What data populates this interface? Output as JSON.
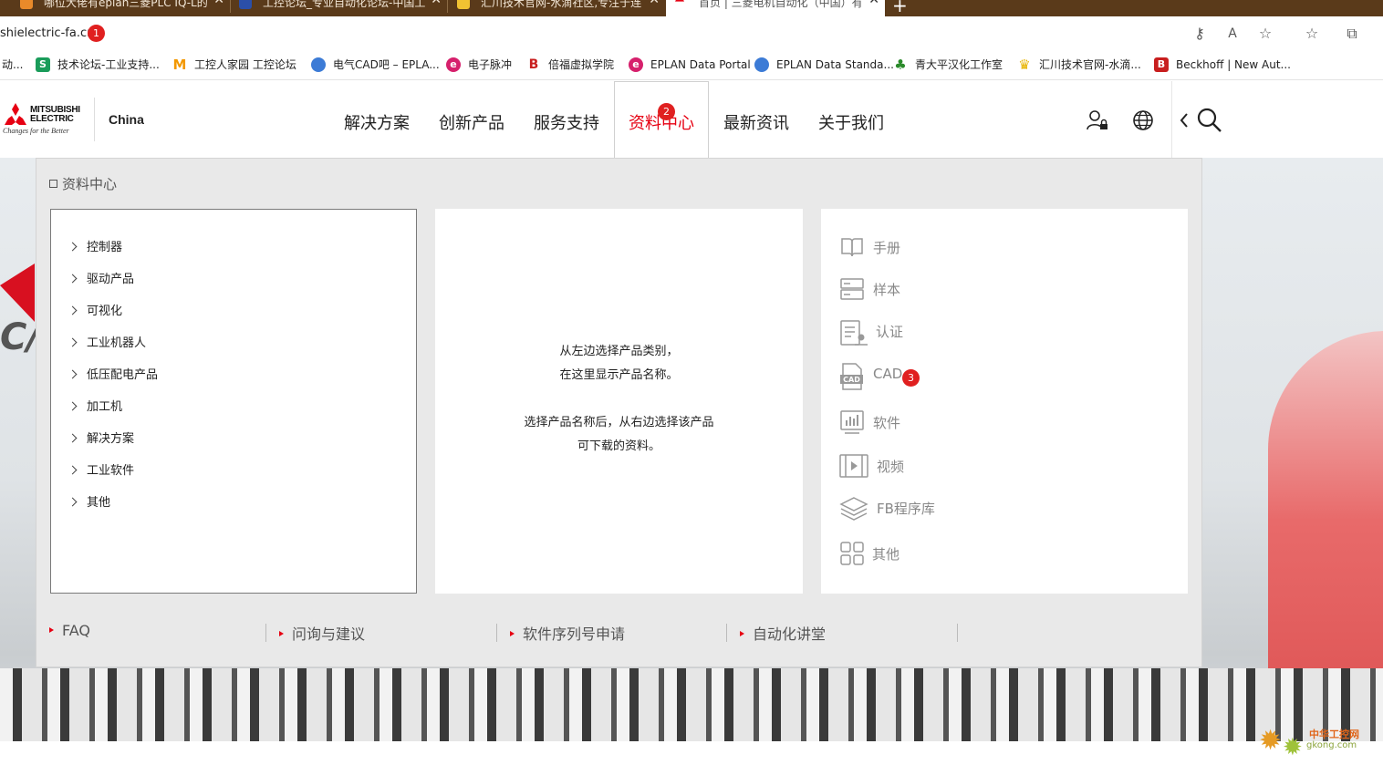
{
  "browser": {
    "tabs": [
      {
        "title": "哪位大佬有eplan三菱PLC IQ-L的",
        "active": false
      },
      {
        "title": "工控论坛_专业自动化论坛-中国工",
        "active": false
      },
      {
        "title": "汇川技术官网-水滴社区,专注于连",
        "active": false
      },
      {
        "title": "首页 | 三菱电机自动化（中国）有",
        "active": true
      }
    ],
    "new_tab": "+",
    "url": "shielectric-fa.cn",
    "close_glyph": "✕",
    "bookmarks": [
      {
        "label": "动...",
        "icon": "",
        "color": "#ffffff"
      },
      {
        "label": "技术论坛-工业支持...",
        "icon": "S",
        "color": "#1a9c5a"
      },
      {
        "label": "工控人家园 工控论坛",
        "icon": "M",
        "color": "#f39800"
      },
      {
        "label": "电气CAD吧 – EPLA...",
        "icon": "◕",
        "color": "#3c7bd6"
      },
      {
        "label": "电子脉冲",
        "icon": "e",
        "color": "#d6206c"
      },
      {
        "label": "倍福虚拟学院",
        "icon": "B",
        "color": "#c81e1e"
      },
      {
        "label": "EPLAN Data Portal",
        "icon": "e",
        "color": "#d6206c"
      },
      {
        "label": "EPLAN Data Standa...",
        "icon": "◕",
        "color": "#3c7bd6"
      },
      {
        "label": "青大平汉化工作室",
        "icon": "♣",
        "color": "#2a8a2a"
      },
      {
        "label": "汇川技术官网-水滴...",
        "icon": "♛",
        "color": "#e8b400"
      },
      {
        "label": "Beckhoff | New Aut...",
        "icon": "B",
        "color": "#c81e1e"
      }
    ]
  },
  "annotations": {
    "badge_1": "1",
    "badge_2": "2",
    "badge_3": "3"
  },
  "site": {
    "logo_line1": "MITSUBISHI",
    "logo_line2": "ELECTRIC",
    "logo_tagline": "Changes for the Better",
    "region": "China",
    "nav": [
      "解决方案",
      "创新产品",
      "服务支持",
      "资料中心",
      "最新资讯",
      "关于我们"
    ],
    "active_nav": "资料中心"
  },
  "mega_menu": {
    "title": "资料中心",
    "categories": [
      "控制器",
      "驱动产品",
      "可视化",
      "工业机器人",
      "低压配电产品",
      "加工机",
      "解决方案",
      "工业软件",
      "其他"
    ],
    "hint_lines": [
      "从左边选择产品类别，",
      "在这里显示产品名称。",
      "",
      "选择产品名称后，从右边选择该产品",
      "可下载的资料。"
    ],
    "resources": [
      {
        "label": "手册",
        "icon": "book-icon"
      },
      {
        "label": "样本",
        "icon": "catalog-icon"
      },
      {
        "label": "认证",
        "icon": "certificate-icon"
      },
      {
        "label": "CAD",
        "icon": "cad-icon"
      },
      {
        "label": "软件",
        "icon": "software-icon"
      },
      {
        "label": "视频",
        "icon": "video-icon"
      },
      {
        "label": "FB程序库",
        "icon": "layers-icon"
      },
      {
        "label": "其他",
        "icon": "grid-icon"
      }
    ],
    "footer_links": [
      "FAQ",
      "问询与建议",
      "软件序列号申请",
      "自动化讲堂"
    ]
  },
  "watermark": {
    "line1": "中华工控网",
    "line2": "gkong.com"
  }
}
